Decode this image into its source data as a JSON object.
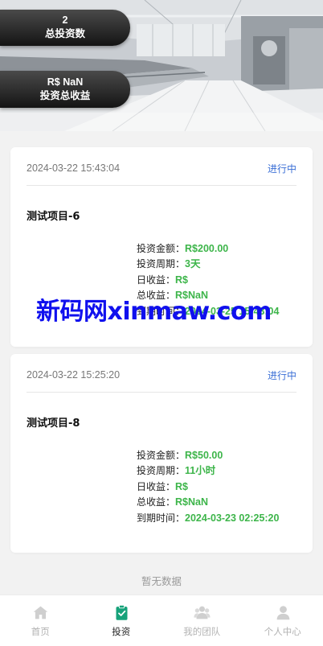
{
  "header": {
    "investment_count": "2",
    "investment_count_label": "总投资数",
    "total_income": "R$ NaN",
    "total_income_label": "投资总收益"
  },
  "orders": [
    {
      "date": "2024-03-22 15:43:04",
      "status": "进行中",
      "title": "测试项目-6",
      "details": [
        {
          "label": "投资金额：",
          "value": "R$200.00"
        },
        {
          "label": "投资周期：",
          "value": "3天"
        },
        {
          "label": "日收益：",
          "value": "R$"
        },
        {
          "label": "总收益：",
          "value": "R$NaN"
        },
        {
          "label": "到期时间：",
          "value": "2024-03-25 15:43:04"
        }
      ]
    },
    {
      "date": "2024-03-22 15:25:20",
      "status": "进行中",
      "title": "测试项目-8",
      "details": [
        {
          "label": "投资金额：",
          "value": "R$50.00"
        },
        {
          "label": "投资周期：",
          "value": "11小时"
        },
        {
          "label": "日收益：",
          "value": "R$"
        },
        {
          "label": "总收益：",
          "value": "R$NaN"
        },
        {
          "label": "到期时间：",
          "value": "2024-03-23 02:25:20"
        }
      ]
    }
  ],
  "watermark": "新码网xinmaw.com",
  "empty_text": "暂无数据",
  "tabbar": {
    "items": [
      {
        "label": "首页",
        "icon": "home-icon"
      },
      {
        "label": "投资",
        "icon": "clipboard-check-icon"
      },
      {
        "label": "我的团队",
        "icon": "team-icon"
      },
      {
        "label": "个人中心",
        "icon": "user-icon"
      }
    ],
    "active_index": 1
  },
  "colors": {
    "accent_green": "#3db54a",
    "status_blue": "#3b6fd6",
    "tab_active": "#16a27a",
    "tab_inactive": "#cfcfcf",
    "watermark_blue": "#1010ee"
  }
}
